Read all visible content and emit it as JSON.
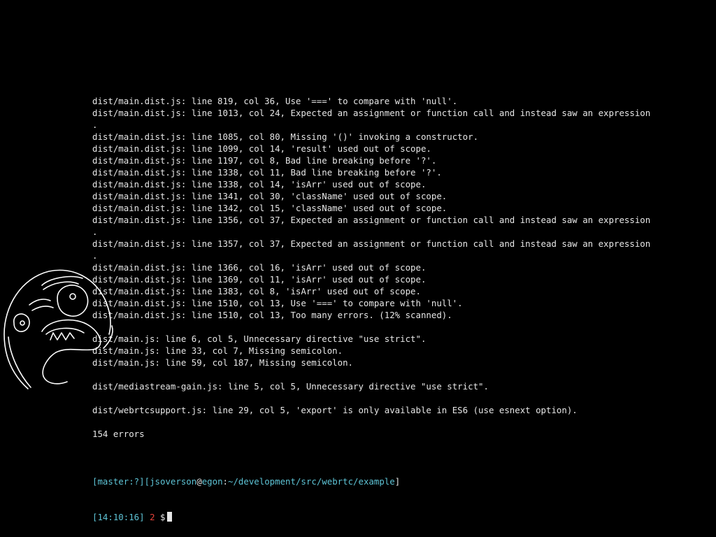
{
  "terminal": {
    "background": "#000000",
    "text_color": "#e6e6e6",
    "prompt_path_color": "#5ec4d6",
    "status_color": "#e8433a"
  },
  "lint_output": [
    "dist/main.dist.js: line 819, col 36, Use '===' to compare with 'null'.",
    "dist/main.dist.js: line 1013, col 24, Expected an assignment or function call and instead saw an expression",
    ".",
    "dist/main.dist.js: line 1085, col 80, Missing '()' invoking a constructor.",
    "dist/main.dist.js: line 1099, col 14, 'result' used out of scope.",
    "dist/main.dist.js: line 1197, col 8, Bad line breaking before '?'.",
    "dist/main.dist.js: line 1338, col 11, Bad line breaking before '?'.",
    "dist/main.dist.js: line 1338, col 14, 'isArr' used out of scope.",
    "dist/main.dist.js: line 1341, col 30, 'className' used out of scope.",
    "dist/main.dist.js: line 1342, col 15, 'className' used out of scope.",
    "dist/main.dist.js: line 1356, col 37, Expected an assignment or function call and instead saw an expression",
    ".",
    "dist/main.dist.js: line 1357, col 37, Expected an assignment or function call and instead saw an expression",
    ".",
    "dist/main.dist.js: line 1366, col 16, 'isArr' used out of scope.",
    "dist/main.dist.js: line 1369, col 11, 'isArr' used out of scope.",
    "dist/main.dist.js: line 1383, col 8, 'isArr' used out of scope.",
    "dist/main.dist.js: line 1510, col 13, Use '===' to compare with 'null'.",
    "dist/main.dist.js: line 1510, col 13, Too many errors. (12% scanned).",
    "",
    "dist/main.js: line 6, col 5, Unnecessary directive \"use strict\".",
    "dist/main.js: line 33, col 7, Missing semicolon.",
    "dist/main.js: line 59, col 187, Missing semicolon.",
    "",
    "dist/mediastream-gain.js: line 5, col 5, Unnecessary directive \"use strict\".",
    "",
    "dist/webrtcsupport.js: line 29, col 5, 'export' is only available in ES6 (use esnext option).",
    "",
    "154 errors",
    ""
  ],
  "prompt": {
    "open_bracket": "[",
    "branch": "master:?",
    "mid_bracket": "][",
    "user": "jsoverson",
    "at": "@",
    "host": "egon",
    "colon": ":",
    "path": "~/development/src/webrtc/example",
    "close_bracket": "]",
    "time_open": "[",
    "time": "14:10:16",
    "time_close": "]",
    "exit_status": "2",
    "dollar": "$"
  },
  "decoration": {
    "icon": "rage-face-icon"
  }
}
